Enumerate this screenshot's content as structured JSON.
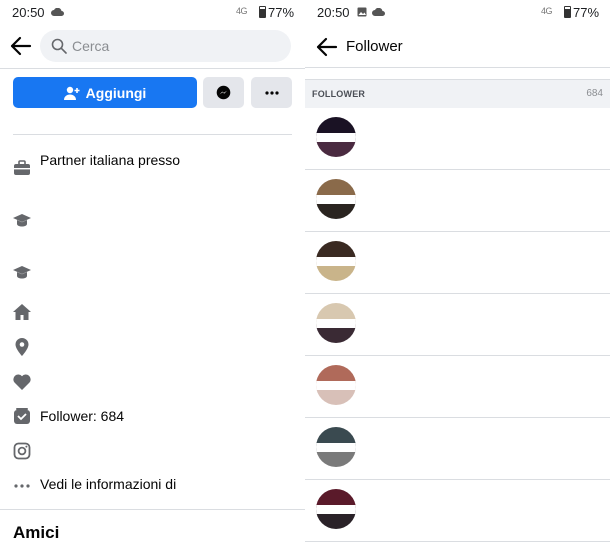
{
  "left": {
    "status": {
      "time": "20:50",
      "battery": "77%",
      "network": "4G"
    },
    "search": {
      "placeholder": "Cerca"
    },
    "actions": {
      "add_label": "Aggiungi"
    },
    "info_rows": [
      {
        "icon": "briefcase-icon",
        "text": "Partner italiana presso"
      },
      {
        "icon": "graduation-cap-icon",
        "text": ""
      },
      {
        "icon": "graduation-cap-icon",
        "text": ""
      },
      {
        "icon": "home-icon",
        "text": ""
      },
      {
        "icon": "location-pin-icon",
        "text": ""
      },
      {
        "icon": "heart-icon",
        "text": ""
      },
      {
        "icon": "followers-icon",
        "text": "Follower: 684"
      },
      {
        "icon": "instagram-icon",
        "text": ""
      },
      {
        "icon": "more-dots-icon",
        "text": "Vedi le informazioni di"
      }
    ],
    "friends_heading": "Amici"
  },
  "right": {
    "status": {
      "time": "20:50",
      "battery": "77%",
      "network": "4G"
    },
    "title": "Follower",
    "section": {
      "label": "FOLLOWER",
      "count": "684"
    },
    "followers": [
      {
        "colors": [
          "#1a1224",
          "#4a2a40"
        ]
      },
      {
        "colors": [
          "#8a6a4a",
          "#2a2420"
        ]
      },
      {
        "colors": [
          "#3a2a22",
          "#c9b48a"
        ]
      },
      {
        "colors": [
          "#d8c8b0",
          "#3a2a34"
        ]
      },
      {
        "colors": [
          "#b06a5a",
          "#d8c0b8"
        ]
      },
      {
        "colors": [
          "#3a4a50",
          "#7a7a7a"
        ]
      },
      {
        "colors": [
          "#5a1a2a",
          "#2a2228"
        ]
      }
    ]
  },
  "colors": {
    "brand_blue": "#1877f2",
    "button_gray": "#e4e6eb",
    "icon_gray": "#65676b"
  }
}
